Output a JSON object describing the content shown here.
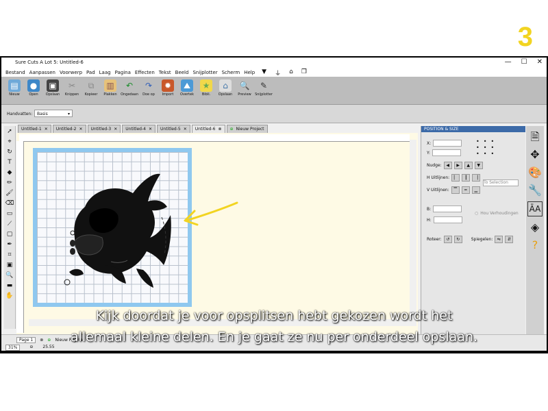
{
  "window": {
    "title": "Sure Cuts A Lot 5: Untitled-6",
    "controls": [
      "—",
      "☐",
      "✕"
    ]
  },
  "menu": [
    "Bestand",
    "Aanpassen",
    "Voorwerp",
    "Pad",
    "Laag",
    "Pagina",
    "Effecten",
    "Tekst",
    "Beeld",
    "Snijplotter",
    "Scherm",
    "Help"
  ],
  "toolbar": [
    {
      "label": "Nieuw",
      "icon": "new-icon"
    },
    {
      "label": "Open",
      "icon": "open-icon"
    },
    {
      "label": "Opslaan",
      "icon": "save-icon"
    },
    {
      "label": "Knippen",
      "icon": "cut-icon"
    },
    {
      "label": "Kopieer",
      "icon": "copy-icon"
    },
    {
      "label": "Plakken",
      "icon": "paste-icon"
    },
    {
      "label": "Ongedaan",
      "icon": "undo-icon"
    },
    {
      "label": "Doe op",
      "icon": "redo-icon"
    },
    {
      "label": "Import",
      "icon": "import-icon"
    },
    {
      "label": "Overtek",
      "icon": "trace-icon"
    },
    {
      "label": "Bibli.",
      "icon": "library-icon"
    },
    {
      "label": "Opslaan",
      "icon": "store-icon"
    },
    {
      "label": "Preview",
      "icon": "preview-icon"
    },
    {
      "label": "Snijplotter",
      "icon": "cutter-icon"
    }
  ],
  "step_number": "3",
  "options": {
    "label": "Handvatten:",
    "value": "Basis"
  },
  "tabs": [
    "Untitled-1",
    "Untitled-2",
    "Untitled-3",
    "Untitled-4",
    "Untitled-5",
    "Untitled-6",
    "Nieuw Project"
  ],
  "panel": {
    "title": "POSITION & SIZE",
    "x_label": "X:",
    "y_label": "Y:",
    "nudge_label": "Nudge:",
    "h_align_label": "H Uitlijnen:",
    "v_align_label": "V Uitlijnen:",
    "align_target": "To Selection",
    "width_label": "B:",
    "height_label": "H:",
    "keep_ratio_label": "Hou Verhoudingen",
    "rotate_label": "Roteer:",
    "mirror_label": "Spiegelen:"
  },
  "status": {
    "page_tab": "Page 1",
    "new_page": "Nieuw Pagina",
    "zoom": "31%",
    "coord": "25.55"
  },
  "subtitle": {
    "line1": "Kijk doordat je voor opsplitsen hebt gekozen wordt het",
    "line2": "allemaal kleine delen. En je gaat ze nu per onderdeel opslaan."
  },
  "colors": {
    "mat": "#8fc8ef",
    "canvas": "#fefae5",
    "arrow": "#f2d421",
    "step_number": "#f2d421",
    "panel_title": "#3c6aa8"
  }
}
